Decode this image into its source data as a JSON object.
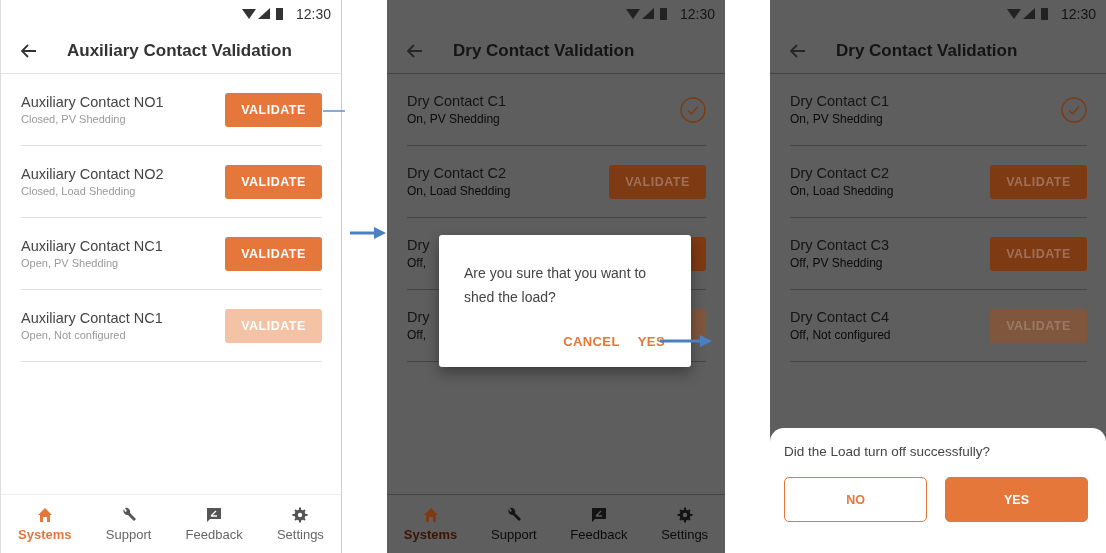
{
  "screens": [
    {
      "dimmed": false,
      "status_time": "12:30",
      "title": "Auxiliary Contact Validation",
      "rows": [
        {
          "title": "Auxiliary Contact NO1",
          "subtitle": "Closed, PV Shedding",
          "action": {
            "kind": "button",
            "label": "VALIDATE",
            "disabled": false
          }
        },
        {
          "title": "Auxiliary Contact NO2",
          "subtitle": "Closed, Load Shedding",
          "action": {
            "kind": "button",
            "label": "VALIDATE",
            "disabled": false
          }
        },
        {
          "title": "Auxiliary Contact NC1",
          "subtitle": "Open, PV Shedding",
          "action": {
            "kind": "button",
            "label": "VALIDATE",
            "disabled": false
          }
        },
        {
          "title": "Auxiliary Contact NC1",
          "subtitle": "Open, Not configured",
          "action": {
            "kind": "button",
            "label": "VALIDATE",
            "disabled": true
          }
        }
      ],
      "nav": [
        {
          "label": "Systems",
          "selected": true
        },
        {
          "label": "Support",
          "selected": false
        },
        {
          "label": "Feedback",
          "selected": false
        },
        {
          "label": "Settings",
          "selected": false
        }
      ]
    },
    {
      "dimmed": true,
      "status_time": "12:30",
      "title": "Dry Contact Validation",
      "rows": [
        {
          "title": "Dry Contact C1",
          "subtitle": "On, PV Shedding",
          "action": {
            "kind": "check"
          }
        },
        {
          "title": "Dry Contact C2",
          "subtitle": "On, Load Shedding",
          "action": {
            "kind": "button",
            "label": "VALIDATE",
            "disabled": false
          }
        },
        {
          "title": "Dry",
          "subtitle": "Off,",
          "action": {
            "kind": "button",
            "disabled": false
          }
        },
        {
          "title": "Dry",
          "subtitle": "Off,",
          "action": {
            "kind": "button",
            "disabled": true
          }
        }
      ],
      "dialog": {
        "message": "Are you sure that you want to shed the load?",
        "buttons": [
          "CANCEL",
          "YES"
        ]
      },
      "nav": [
        {
          "label": "Systems",
          "selected": true
        },
        {
          "label": "Support",
          "selected": false
        },
        {
          "label": "Feedback",
          "selected": false
        },
        {
          "label": "Settings",
          "selected": false
        }
      ]
    },
    {
      "dimmed": true,
      "status_time": "12:30",
      "title": "Dry Contact Validation",
      "rows": [
        {
          "title": "Dry Contact C1",
          "subtitle": "On, PV Shedding",
          "action": {
            "kind": "check"
          }
        },
        {
          "title": "Dry Contact C2",
          "subtitle": "On, Load Shedding",
          "action": {
            "kind": "button",
            "label": "VALIDATE",
            "disabled": false
          }
        },
        {
          "title": "Dry Contact C3",
          "subtitle": "Off, PV Shedding",
          "action": {
            "kind": "button",
            "label": "VALIDATE",
            "disabled": false
          }
        },
        {
          "title": "Dry Contact C4",
          "subtitle": "Off, Not configured",
          "action": {
            "kind": "button",
            "label": "VALIDATE",
            "disabled": true
          }
        }
      ],
      "sheet": {
        "question": "Did the Load turn off successfully?",
        "buttons": [
          {
            "label": "NO",
            "kind": "outline"
          },
          {
            "label": "YES",
            "kind": "filled"
          }
        ]
      }
    }
  ]
}
